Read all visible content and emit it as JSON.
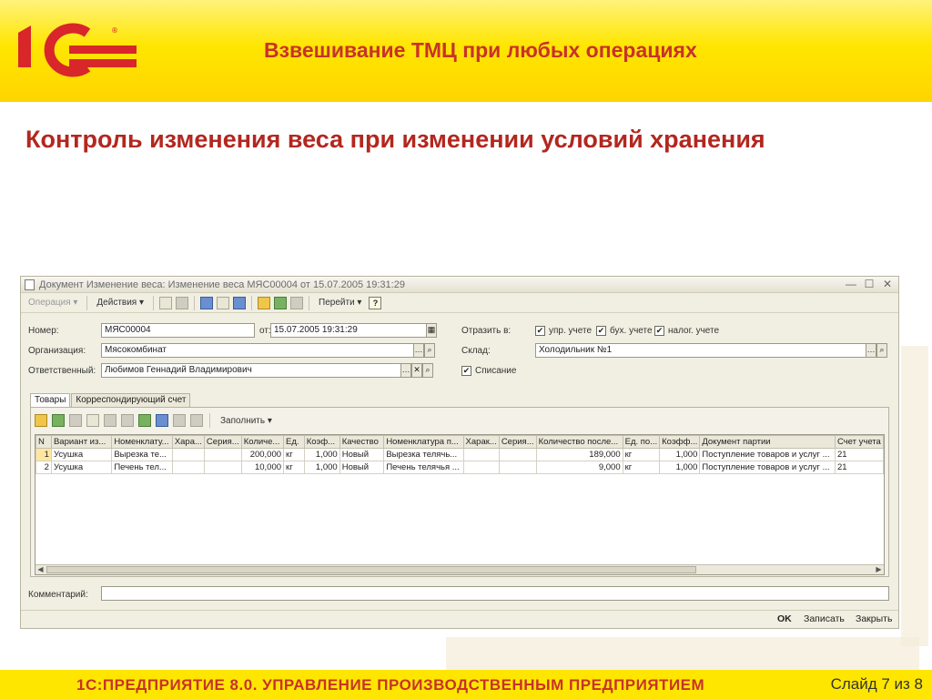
{
  "slide": {
    "title": "Взвешивание ТМЦ при любых операциях",
    "subtitle": "Контроль изменения веса при изменении условий хранения",
    "footer_left": "1С:ПРЕДПРИЯТИЕ 8.0. УПРАВЛЕНИЕ ПРОИЗВОДСТВЕННЫМ ПРЕДПРИЯТИЕМ",
    "footer_right": "Слайд 7 из 8",
    "brand_color": "#c8322a",
    "header_color": "#ffe600"
  },
  "window": {
    "title": "Документ Изменение веса: Изменение веса МЯС00004 от 15.07.2005 19:31:29",
    "controls": {
      "minimize": "—",
      "maximize": "☐",
      "close": "✕"
    },
    "toolbar": {
      "operation": "Операция ▾",
      "actions": "Действия ▾",
      "goto": "Перейти ▾",
      "help": "?"
    },
    "form": {
      "number_label": "Номер:",
      "number_value": "МЯС00004",
      "date_label": "от:",
      "date_value": "15.07.2005 19:31:29",
      "reflect_label": "Отразить в:",
      "chk_mgmt": "упр. учете",
      "chk_acc": "бух. учете",
      "chk_tax": "налог. учете",
      "org_label": "Организация:",
      "org_value": "Мясокомбинат",
      "warehouse_label": "Склад:",
      "warehouse_value": "Холодильник №1",
      "resp_label": "Ответственный:",
      "resp_value": "Любимов Геннадий Владимирович",
      "writeoff_label": "Списание",
      "check_mark": "✔"
    },
    "tabs": [
      "Товары",
      "Корреспондирующий счет"
    ],
    "panel": {
      "fill_label": "Заполнить ▾"
    },
    "table": {
      "columns": [
        "N",
        "Вариант из...",
        "Номенклату...",
        "Хара...",
        "Серия...",
        "Количе...",
        "Ед.",
        "Коэф...",
        "Качество",
        "Номенклатура п...",
        "Харак...",
        "Серия...",
        "Количество после...",
        "Ед. по...",
        "Коэфф...",
        "Документ партии",
        "Счет учета"
      ],
      "rows": [
        [
          "1",
          "Усушка",
          "Вырезка те...",
          "",
          "",
          "200,000",
          "кг",
          "1,000",
          "Новый",
          "Вырезка телячь...",
          "",
          "",
          "189,000",
          "кг",
          "1,000",
          "Поступление товаров и услуг ...",
          "21"
        ],
        [
          "2",
          "Усушка",
          "Печень тел...",
          "",
          "",
          "10,000",
          "кг",
          "1,000",
          "Новый",
          "Печень телячья ...",
          "",
          "",
          "9,000",
          "кг",
          "1,000",
          "Поступление товаров и услуг ...",
          "21"
        ]
      ]
    },
    "comment_label": "Комментарий:",
    "comment_value": "",
    "buttons": {
      "ok": "OK",
      "save": "Записать",
      "close": "Закрыть"
    }
  }
}
